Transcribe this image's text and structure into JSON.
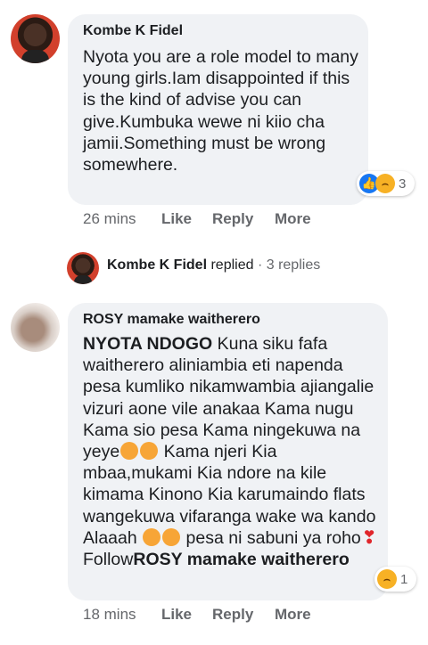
{
  "comment1": {
    "author": "Kombe K Fidel",
    "text": "Nyota you are a role model to many young girls.Iam disappointed if this is the kind of advise you can give.Kumbuka wewe ni kiio cha jamii.Something must be wrong somewhere.",
    "reactions": {
      "icons": [
        "like-icon",
        "haha-icon"
      ],
      "count": "3"
    },
    "time": "26 mins",
    "like_label": "Like",
    "reply_label": "Reply",
    "more_label": "More"
  },
  "replies": {
    "author": "Kombe K Fidel",
    "verb": "replied",
    "separator": "·",
    "count_label": "3 replies"
  },
  "comment2": {
    "author": "ROSY mamake waitherero",
    "tag": "NYOTA NDOGO",
    "text_part1": " Kuna siku fafa waitherero aliniambia eti napenda pesa kumliko nikamwambia ajiangalie vizuri aone vile anakaa Kama nugu Kama sio pesa Kama ningekuwa na yeye",
    "text_part2": " Kama njeri Kia mbaa,mukami Kia ndore na kile kimama Kinono Kia karumaindo flats wangekuwa vifaranga wake wa kando Alaaah ",
    "text_part3": " pesa ni sabuni ya roho",
    "follow_label": "Follow",
    "follow_name": "ROSY mamake waitherero",
    "reactions": {
      "icons": [
        "haha-icon"
      ],
      "count": "1"
    },
    "time": "18 mins",
    "like_label": "Like",
    "reply_label": "Reply",
    "more_label": "More"
  }
}
